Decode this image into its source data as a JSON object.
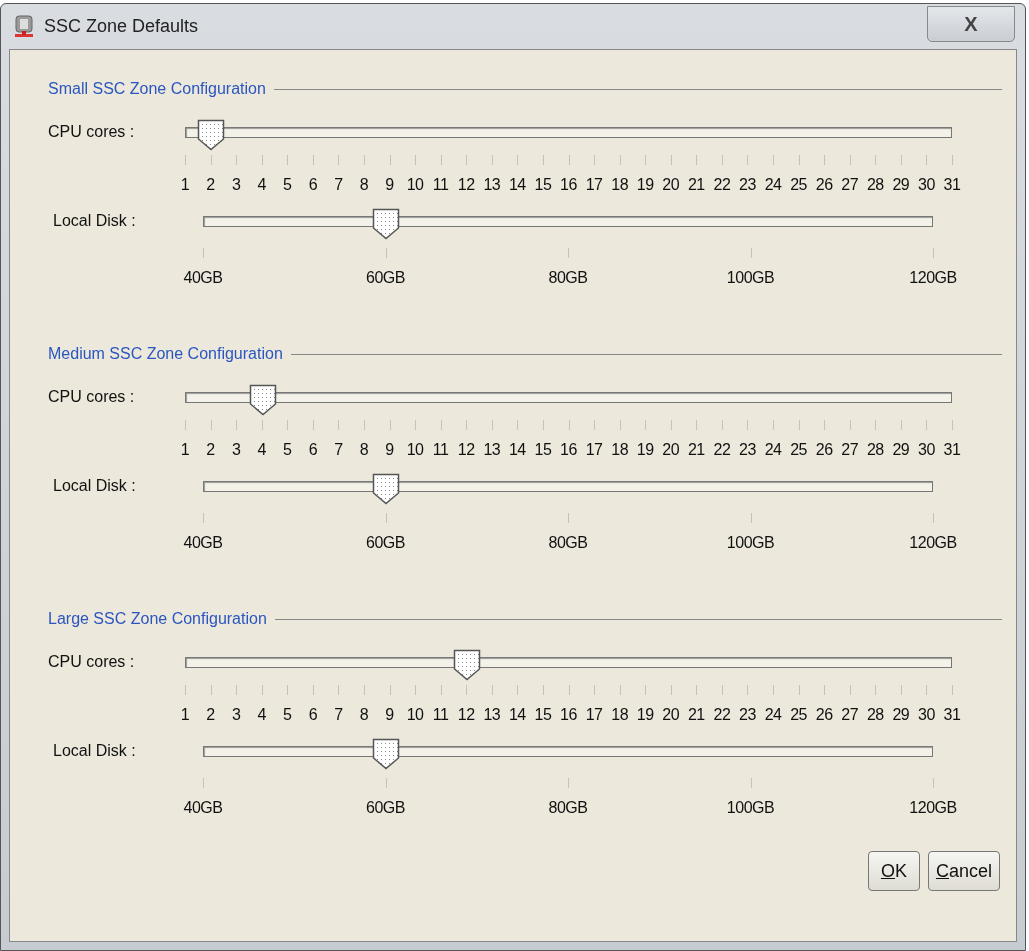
{
  "window": {
    "title": "SSC Zone Defaults",
    "close_button": "X"
  },
  "sections": [
    {
      "title": "Small SSC Zone Configuration",
      "sliders": [
        {
          "kind": "cores",
          "label": "CPU cores :",
          "level": 0.033,
          "scale": [
            "1",
            "2",
            "3",
            "4",
            "5",
            "6",
            "7",
            "8",
            "9",
            "10",
            "11",
            "12",
            "13",
            "14",
            "15",
            "16",
            "17",
            "18",
            "19",
            "20",
            "21",
            "22",
            "23",
            "24",
            "25",
            "26",
            "27",
            "28",
            "29",
            "30",
            "31"
          ]
        },
        {
          "kind": "disk",
          "label": "Local Disk :",
          "level": 0.25,
          "scale": [
            "40GB",
            "60GB",
            "80GB",
            "100GB",
            "120GB"
          ]
        }
      ]
    },
    {
      "title": "Medium SSC Zone Configuration",
      "sliders": [
        {
          "kind": "cores",
          "label": "CPU cores :",
          "level": 0.1,
          "scale": [
            "1",
            "2",
            "3",
            "4",
            "5",
            "6",
            "7",
            "8",
            "9",
            "10",
            "11",
            "12",
            "13",
            "14",
            "15",
            "16",
            "17",
            "18",
            "19",
            "20",
            "21",
            "22",
            "23",
            "24",
            "25",
            "26",
            "27",
            "28",
            "29",
            "30",
            "31"
          ]
        },
        {
          "kind": "disk",
          "label": "Local Disk :",
          "level": 0.25,
          "scale": [
            "40GB",
            "60GB",
            "80GB",
            "100GB",
            "120GB"
          ]
        }
      ]
    },
    {
      "title": "Large SSC Zone Configuration",
      "sliders": [
        {
          "kind": "cores",
          "label": "CPU cores :",
          "level": 0.367,
          "scale": [
            "1",
            "2",
            "3",
            "4",
            "5",
            "6",
            "7",
            "8",
            "9",
            "10",
            "11",
            "12",
            "13",
            "14",
            "15",
            "16",
            "17",
            "18",
            "19",
            "20",
            "21",
            "22",
            "23",
            "24",
            "25",
            "26",
            "27",
            "28",
            "29",
            "30",
            "31"
          ]
        },
        {
          "kind": "disk",
          "label": "Local Disk :",
          "level": 0.25,
          "scale": [
            "40GB",
            "60GB",
            "80GB",
            "100GB",
            "120GB"
          ]
        }
      ]
    }
  ],
  "buttons": [
    "OK",
    "Cancel"
  ]
}
